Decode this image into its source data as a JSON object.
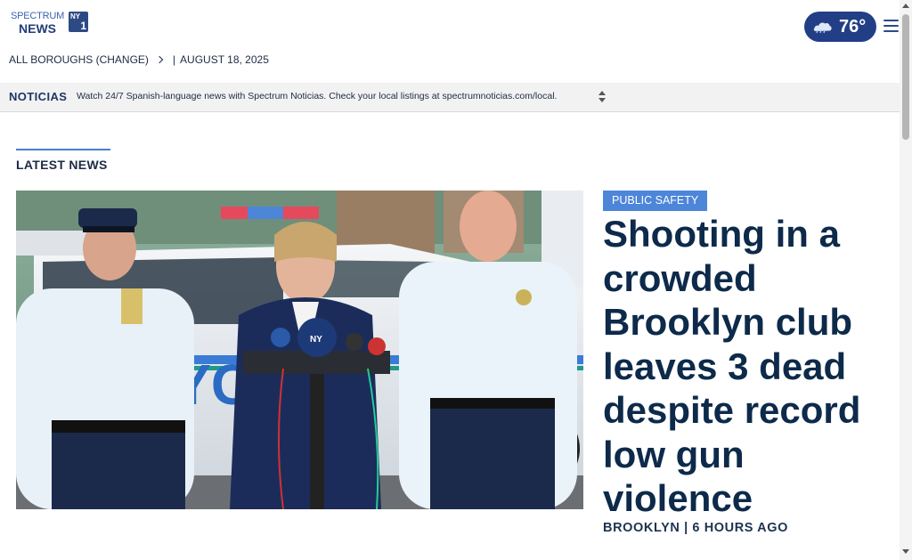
{
  "header": {
    "logo": {
      "top": "SPECTRUM",
      "bottom": "NEWS",
      "badge_top": "NY",
      "badge_bottom": "1"
    },
    "weather": {
      "temperature": "76°",
      "icon": "cloud-icon"
    },
    "menu_icon": "hamburger-menu-icon"
  },
  "location_bar": {
    "borough_label": "ALL BOROUGHS (CHANGE)",
    "separator": "|",
    "date": "AUGUST 18, 2025"
  },
  "ticker": {
    "label": "NOTICIAS",
    "text": "Watch 24/7 Spanish-language news with Spectrum Noticias. Check your local listings at spectrumnoticias.com/local."
  },
  "section": {
    "title": "LATEST NEWS"
  },
  "lead_story": {
    "category": "PUBLIC SAFETY",
    "headline": "Shooting in a crowded Brooklyn club leaves 3 dead despite record low gun violence",
    "borough": "BROOKLYN",
    "byline_separator": "|",
    "time_ago": "6 HOURS AGO",
    "photo_badges": {
      "nyc": "NYC",
      "nypd": "NY"
    }
  },
  "colors": {
    "brand_navy": "#223e86",
    "tag_blue": "#4d85d9",
    "headline": "#0d2a4a",
    "accent_rule": "#4a7fd4"
  }
}
